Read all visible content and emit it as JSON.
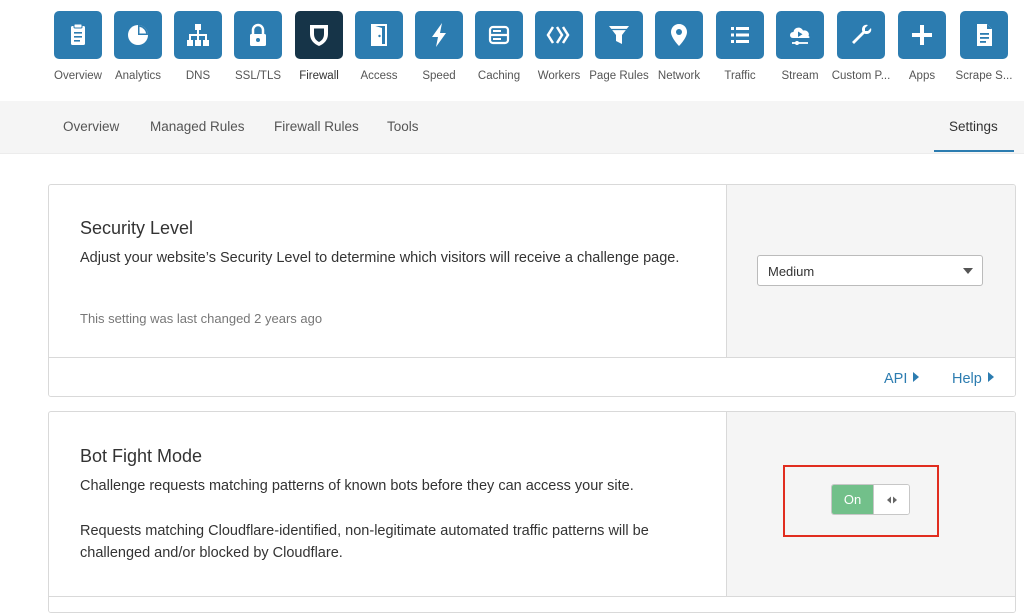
{
  "apps": [
    {
      "label": "Overview",
      "icon": "clipboard-icon"
    },
    {
      "label": "Analytics",
      "icon": "pie-chart-icon"
    },
    {
      "label": "DNS",
      "icon": "network-tree-icon"
    },
    {
      "label": "SSL/TLS",
      "icon": "lock-icon"
    },
    {
      "label": "Firewall",
      "icon": "shield-icon"
    },
    {
      "label": "Access",
      "icon": "door-icon"
    },
    {
      "label": "Speed",
      "icon": "lightning-icon"
    },
    {
      "label": "Caching",
      "icon": "server-icon"
    },
    {
      "label": "Workers",
      "icon": "workers-icon"
    },
    {
      "label": "Page Rules",
      "icon": "filter-icon"
    },
    {
      "label": "Network",
      "icon": "location-pin-icon"
    },
    {
      "label": "Traffic",
      "icon": "list-icon"
    },
    {
      "label": "Stream",
      "icon": "cloud-play-icon"
    },
    {
      "label": "Custom P...",
      "icon": "wrench-icon"
    },
    {
      "label": "Apps",
      "icon": "plus-icon"
    },
    {
      "label": "Scrape S...",
      "icon": "document-icon"
    }
  ],
  "active_app": "Firewall",
  "subnav": {
    "tabs": [
      "Overview",
      "Managed Rules",
      "Firewall Rules",
      "Tools"
    ],
    "settings": "Settings",
    "active": "Settings"
  },
  "security_level": {
    "title": "Security Level",
    "description": "Adjust your website’s Security Level to determine which visitors will receive a challenge page.",
    "meta": "This setting was last changed 2 years ago",
    "select_value": "Medium",
    "api_link": "API",
    "help_link": "Help"
  },
  "bot_fight_mode": {
    "title": "Bot Fight Mode",
    "description": "Challenge requests matching patterns of known bots before they can access your site.",
    "detail": "Requests matching Cloudflare-identified, non-legitimate automated traffic patterns will be challenged and/or blocked by Cloudflare.",
    "toggle_label": "On"
  },
  "colors": {
    "tile": "#2c7cb0",
    "tile_active": "#163448",
    "toggle_on": "#72c08a",
    "highlight": "#e12d1f",
    "link": "#2c7cb0"
  }
}
